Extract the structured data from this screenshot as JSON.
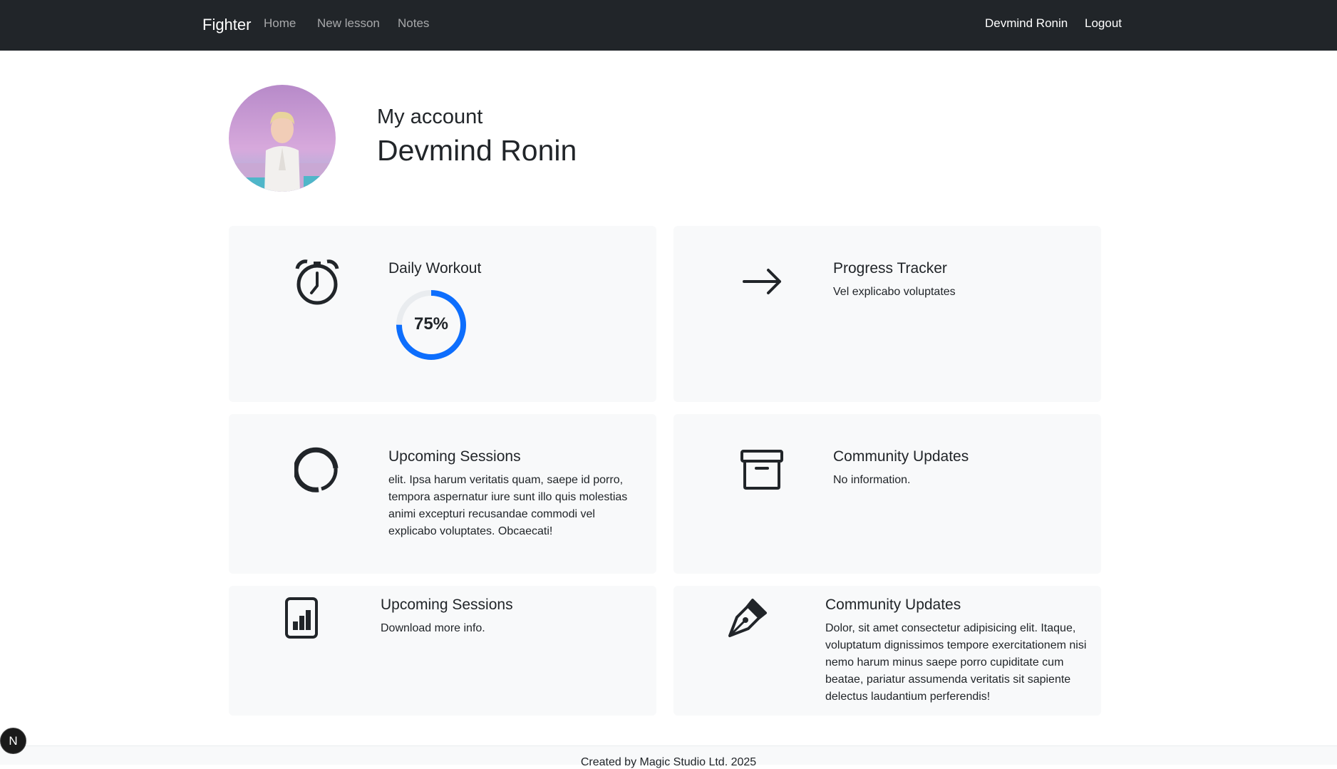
{
  "navbar": {
    "brand": "Fighter",
    "links": [
      "Home",
      "New lesson",
      "Notes"
    ],
    "user": "Devmind Ronin",
    "logout": "Logout"
  },
  "profile": {
    "subtitle": "My account",
    "name": "Devmind Ronin"
  },
  "cards": [
    {
      "icon": "alarm-clock-icon",
      "title": "Daily Workout",
      "progress": 75,
      "progress_label": "75%"
    },
    {
      "icon": "arrow-right-icon",
      "title": "Progress Tracker",
      "text": "Vel explicabo voluptates"
    },
    {
      "icon": "circle-ring-icon",
      "title": "Upcoming Sessions",
      "text": "elit. Ipsa harum veritatis quam, saepe id porro, tempora aspernatur iure sunt illo quis molestias animi excepturi recusandae commodi vel explicabo voluptates. Obcaecati!"
    },
    {
      "icon": "archive-box-icon",
      "title": "Community Updates",
      "text": "No information."
    },
    {
      "icon": "bar-chart-file-icon",
      "title": "Upcoming Sessions",
      "text": "Download more info."
    },
    {
      "icon": "pen-nib-icon",
      "title": "Community Updates",
      "text": "Dolor, sit amet consectetur adipisicing elit. Itaque, voluptatum dignissimos tempore exercitationem nisi nemo harum minus saepe porro cupiditate cum beatae, pariatur assumenda veritatis sit sapiente delectus laudantium perferendis!"
    }
  ],
  "footer": {
    "text": "Created by Magic Studio Ltd. 2025"
  },
  "badge": {
    "letter": "N"
  },
  "colors": {
    "navbar": "#212529",
    "card": "#f8f9fa",
    "accent": "#0d6efd"
  }
}
